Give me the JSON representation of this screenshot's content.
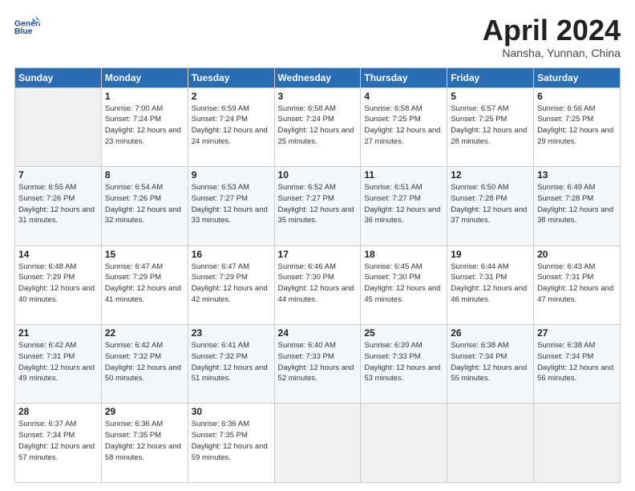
{
  "header": {
    "title": "April 2024",
    "subtitle": "Nansha, Yunnan, China"
  },
  "days_of_week": [
    "Sunday",
    "Monday",
    "Tuesday",
    "Wednesday",
    "Thursday",
    "Friday",
    "Saturday"
  ],
  "weeks": [
    [
      {
        "day": "",
        "sunrise": "",
        "sunset": "",
        "daylight": ""
      },
      {
        "day": "1",
        "sunrise": "Sunrise: 7:00 AM",
        "sunset": "Sunset: 7:24 PM",
        "daylight": "Daylight: 12 hours and 23 minutes."
      },
      {
        "day": "2",
        "sunrise": "Sunrise: 6:59 AM",
        "sunset": "Sunset: 7:24 PM",
        "daylight": "Daylight: 12 hours and 24 minutes."
      },
      {
        "day": "3",
        "sunrise": "Sunrise: 6:58 AM",
        "sunset": "Sunset: 7:24 PM",
        "daylight": "Daylight: 12 hours and 25 minutes."
      },
      {
        "day": "4",
        "sunrise": "Sunrise: 6:58 AM",
        "sunset": "Sunset: 7:25 PM",
        "daylight": "Daylight: 12 hours and 27 minutes."
      },
      {
        "day": "5",
        "sunrise": "Sunrise: 6:57 AM",
        "sunset": "Sunset: 7:25 PM",
        "daylight": "Daylight: 12 hours and 28 minutes."
      },
      {
        "day": "6",
        "sunrise": "Sunrise: 6:56 AM",
        "sunset": "Sunset: 7:25 PM",
        "daylight": "Daylight: 12 hours and 29 minutes."
      }
    ],
    [
      {
        "day": "7",
        "sunrise": "Sunrise: 6:55 AM",
        "sunset": "Sunset: 7:26 PM",
        "daylight": "Daylight: 12 hours and 31 minutes."
      },
      {
        "day": "8",
        "sunrise": "Sunrise: 6:54 AM",
        "sunset": "Sunset: 7:26 PM",
        "daylight": "Daylight: 12 hours and 32 minutes."
      },
      {
        "day": "9",
        "sunrise": "Sunrise: 6:53 AM",
        "sunset": "Sunset: 7:27 PM",
        "daylight": "Daylight: 12 hours and 33 minutes."
      },
      {
        "day": "10",
        "sunrise": "Sunrise: 6:52 AM",
        "sunset": "Sunset: 7:27 PM",
        "daylight": "Daylight: 12 hours and 35 minutes."
      },
      {
        "day": "11",
        "sunrise": "Sunrise: 6:51 AM",
        "sunset": "Sunset: 7:27 PM",
        "daylight": "Daylight: 12 hours and 36 minutes."
      },
      {
        "day": "12",
        "sunrise": "Sunrise: 6:50 AM",
        "sunset": "Sunset: 7:28 PM",
        "daylight": "Daylight: 12 hours and 37 minutes."
      },
      {
        "day": "13",
        "sunrise": "Sunrise: 6:49 AM",
        "sunset": "Sunset: 7:28 PM",
        "daylight": "Daylight: 12 hours and 38 minutes."
      }
    ],
    [
      {
        "day": "14",
        "sunrise": "Sunrise: 6:48 AM",
        "sunset": "Sunset: 7:29 PM",
        "daylight": "Daylight: 12 hours and 40 minutes."
      },
      {
        "day": "15",
        "sunrise": "Sunrise: 6:47 AM",
        "sunset": "Sunset: 7:29 PM",
        "daylight": "Daylight: 12 hours and 41 minutes."
      },
      {
        "day": "16",
        "sunrise": "Sunrise: 6:47 AM",
        "sunset": "Sunset: 7:29 PM",
        "daylight": "Daylight: 12 hours and 42 minutes."
      },
      {
        "day": "17",
        "sunrise": "Sunrise: 6:46 AM",
        "sunset": "Sunset: 7:30 PM",
        "daylight": "Daylight: 12 hours and 44 minutes."
      },
      {
        "day": "18",
        "sunrise": "Sunrise: 6:45 AM",
        "sunset": "Sunset: 7:30 PM",
        "daylight": "Daylight: 12 hours and 45 minutes."
      },
      {
        "day": "19",
        "sunrise": "Sunrise: 6:44 AM",
        "sunset": "Sunset: 7:31 PM",
        "daylight": "Daylight: 12 hours and 46 minutes."
      },
      {
        "day": "20",
        "sunrise": "Sunrise: 6:43 AM",
        "sunset": "Sunset: 7:31 PM",
        "daylight": "Daylight: 12 hours and 47 minutes."
      }
    ],
    [
      {
        "day": "21",
        "sunrise": "Sunrise: 6:42 AM",
        "sunset": "Sunset: 7:31 PM",
        "daylight": "Daylight: 12 hours and 49 minutes."
      },
      {
        "day": "22",
        "sunrise": "Sunrise: 6:42 AM",
        "sunset": "Sunset: 7:32 PM",
        "daylight": "Daylight: 12 hours and 50 minutes."
      },
      {
        "day": "23",
        "sunrise": "Sunrise: 6:41 AM",
        "sunset": "Sunset: 7:32 PM",
        "daylight": "Daylight: 12 hours and 51 minutes."
      },
      {
        "day": "24",
        "sunrise": "Sunrise: 6:40 AM",
        "sunset": "Sunset: 7:33 PM",
        "daylight": "Daylight: 12 hours and 52 minutes."
      },
      {
        "day": "25",
        "sunrise": "Sunrise: 6:39 AM",
        "sunset": "Sunset: 7:33 PM",
        "daylight": "Daylight: 12 hours and 53 minutes."
      },
      {
        "day": "26",
        "sunrise": "Sunrise: 6:38 AM",
        "sunset": "Sunset: 7:34 PM",
        "daylight": "Daylight: 12 hours and 55 minutes."
      },
      {
        "day": "27",
        "sunrise": "Sunrise: 6:38 AM",
        "sunset": "Sunset: 7:34 PM",
        "daylight": "Daylight: 12 hours and 56 minutes."
      }
    ],
    [
      {
        "day": "28",
        "sunrise": "Sunrise: 6:37 AM",
        "sunset": "Sunset: 7:34 PM",
        "daylight": "Daylight: 12 hours and 57 minutes."
      },
      {
        "day": "29",
        "sunrise": "Sunrise: 6:36 AM",
        "sunset": "Sunset: 7:35 PM",
        "daylight": "Daylight: 12 hours and 58 minutes."
      },
      {
        "day": "30",
        "sunrise": "Sunrise: 6:36 AM",
        "sunset": "Sunset: 7:35 PM",
        "daylight": "Daylight: 12 hours and 59 minutes."
      },
      {
        "day": "",
        "sunrise": "",
        "sunset": "",
        "daylight": ""
      },
      {
        "day": "",
        "sunrise": "",
        "sunset": "",
        "daylight": ""
      },
      {
        "day": "",
        "sunrise": "",
        "sunset": "",
        "daylight": ""
      },
      {
        "day": "",
        "sunrise": "",
        "sunset": "",
        "daylight": ""
      }
    ]
  ]
}
